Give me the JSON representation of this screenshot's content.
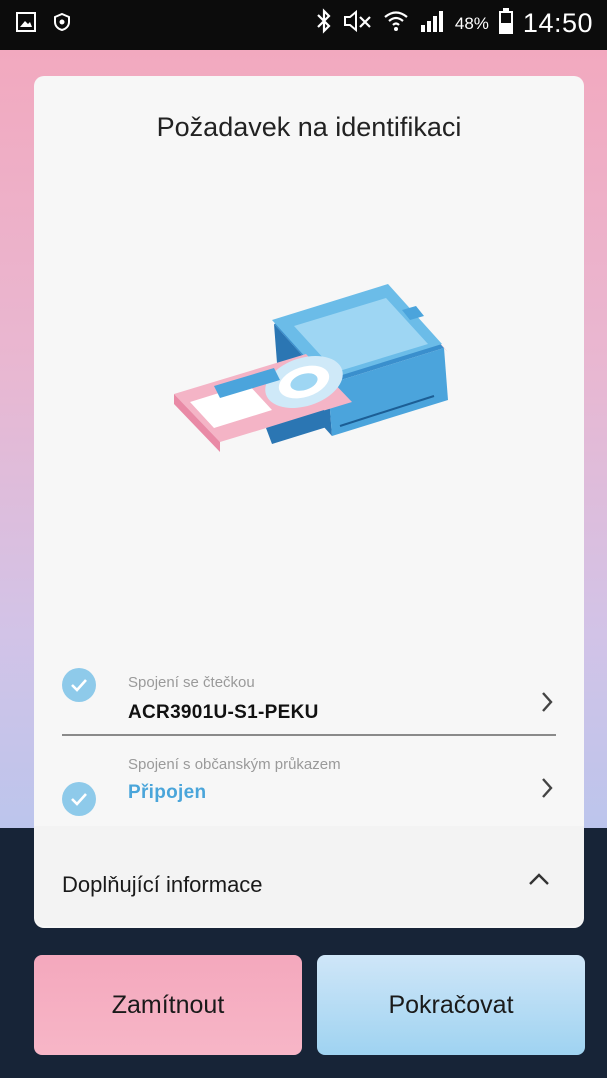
{
  "status_bar": {
    "battery_percent": "48%",
    "time": "14:50",
    "icons": [
      "gallery-icon",
      "shield-icon",
      "bluetooth-icon",
      "mute-icon",
      "wifi-icon",
      "signal-icon",
      "battery-icon"
    ]
  },
  "card": {
    "title": "Požadavek na identifikaci",
    "illustration": "card-reader-icon",
    "connections": [
      {
        "label": "Spojení se čtečkou",
        "value": "ACR3901U-S1-PEKU",
        "status": "checked"
      },
      {
        "label": "Spojení s občanským průkazem",
        "value": "Připojen",
        "status": "checked"
      }
    ],
    "extra_info": {
      "label": "Doplňující informace",
      "expanded": true
    }
  },
  "actions": {
    "reject": "Zamítnout",
    "continue": "Pokračovat"
  },
  "colors": {
    "accent": "#4aa5da",
    "check": "#8ecaea",
    "reject_bg": "#f4a8bd",
    "continue_bg": "#a9d8f3",
    "dark_bg": "#172437"
  }
}
